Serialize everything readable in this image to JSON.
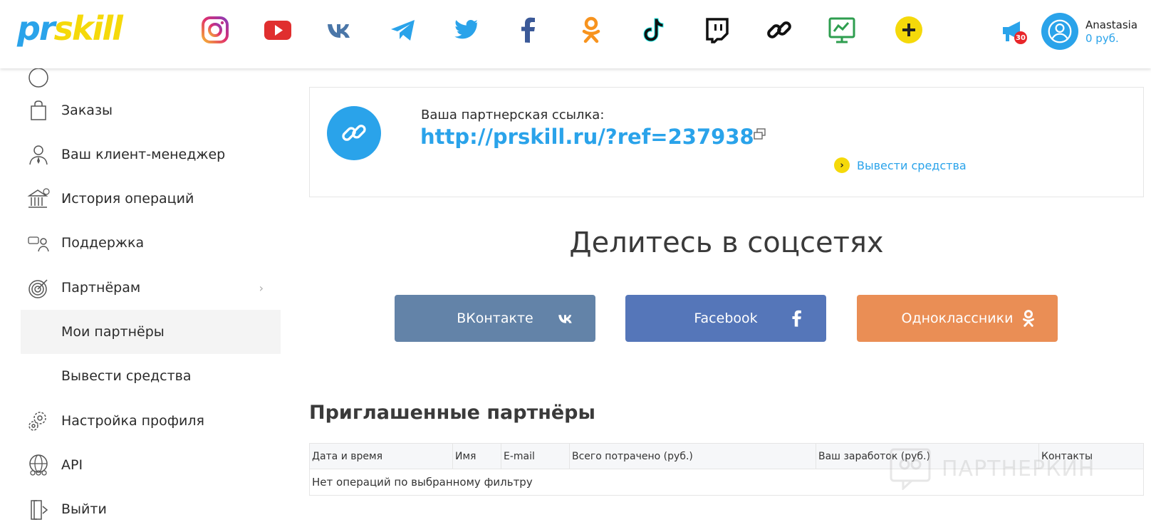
{
  "header": {
    "logo_pr": "pr",
    "logo_skill": "skill",
    "social_icons": [
      "instagram-icon",
      "youtube-icon",
      "vk-icon",
      "telegram-icon",
      "twitter-icon",
      "facebook-icon",
      "odnoklassniki-icon",
      "tiktok-icon",
      "twitch-icon",
      "link-icon",
      "analytics-icon",
      "add-icon"
    ],
    "notification_count": "30",
    "user_name": "Anastasia",
    "user_balance": "0 руб."
  },
  "sidebar": {
    "items": [
      {
        "label": "Заказы"
      },
      {
        "label": "Ваш клиент-менеджер"
      },
      {
        "label": "История операций"
      },
      {
        "label": "Поддержка"
      },
      {
        "label": "Партнёрам"
      },
      {
        "label": "Мои партнёры"
      },
      {
        "label": "Вывести средства"
      },
      {
        "label": "Настройка профиля"
      },
      {
        "label": "API"
      },
      {
        "label": "Выйти"
      }
    ]
  },
  "referral": {
    "title": "Ваша партнерская ссылка:",
    "link": "http://prskill.ru/?ref=237938",
    "withdraw_label": "Вывести средства"
  },
  "share": {
    "title": "Делитесь в соцсетях",
    "vk_label": "ВКонтакте",
    "fb_label": "Facebook",
    "ok_label": "Одноклассники"
  },
  "invited": {
    "title": "Приглашенные партнёры",
    "columns": [
      "Дата и время",
      "Имя",
      "E-mail",
      "Всего потрачено (руб.)",
      "Ваш заработок (руб.)",
      "Контакты"
    ],
    "empty_text": "Нет операций по выбранному фильтру"
  },
  "watermark": {
    "text": "ПАРТНЕРКИН"
  },
  "colors": {
    "accent": "#2aa3ea",
    "logo_yellow": "#f5d90a",
    "vk": "#6383a8",
    "facebook": "#5576b9",
    "odnoklassniki": "#ea8e55"
  }
}
